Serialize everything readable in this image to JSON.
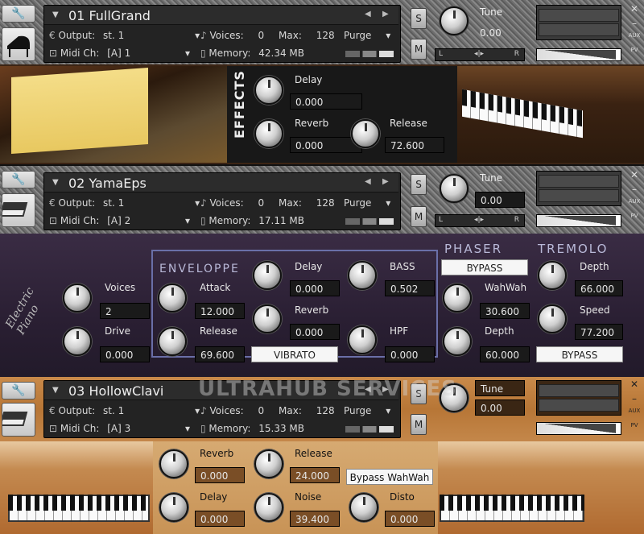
{
  "instruments": [
    {
      "name": "01 FullGrand",
      "output_label": "Output:",
      "output": "st. 1",
      "voices_label": "Voices:",
      "voices": "0",
      "max_label": "Max:",
      "max": "128",
      "purge": "Purge",
      "midi_label": "Midi Ch:",
      "midi": "[A]  1",
      "memory_label": "Memory:",
      "memory": "42.34 MB",
      "tune_label": "Tune",
      "tune": "0.00",
      "s": "S",
      "m": "M",
      "l": "L",
      "r": "R",
      "aux": "AUX",
      "pv": "PV"
    },
    {
      "name": "02 YamaEps",
      "output_label": "Output:",
      "output": "st. 1",
      "voices_label": "Voices:",
      "voices": "0",
      "max_label": "Max:",
      "max": "128",
      "purge": "Purge",
      "midi_label": "Midi Ch:",
      "midi": "[A]  2",
      "memory_label": "Memory:",
      "memory": "17.11 MB",
      "tune_label": "Tune",
      "tune": "0.00",
      "s": "S",
      "m": "M",
      "l": "L",
      "r": "R",
      "aux": "AUX",
      "pv": "PV"
    },
    {
      "name": "03 HollowClavi",
      "output_label": "Output:",
      "output": "st. 1",
      "voices_label": "Voices:",
      "voices": "0",
      "max_label": "Max:",
      "max": "128",
      "purge": "Purge",
      "midi_label": "Midi Ch:",
      "midi": "[A]  3",
      "memory_label": "Memory:",
      "memory": "15.33 MB",
      "tune_label": "Tune",
      "tune": "0.00",
      "s": "S",
      "m": "M",
      "l": "L",
      "r": "R",
      "aux": "AUX",
      "pv": "PV"
    }
  ],
  "effects1": {
    "title": "EFFECTS",
    "delay_label": "Delay",
    "delay": "0.000",
    "reverb_label": "Reverb",
    "reverb": "0.000",
    "release_label": "Release",
    "release": "72.600"
  },
  "effects2": {
    "enveloppe": "ENVELOPPE",
    "phaser": "PHASER",
    "tremolo": "TREMOLO",
    "voices_label": "Voices",
    "voices": "2",
    "drive_label": "Drive",
    "drive": "0.000",
    "attack_label": "Attack",
    "attack": "12.000",
    "release_label": "Release",
    "release": "69.600",
    "delay_label": "Delay",
    "delay": "0.000",
    "reverb_label": "Reverb",
    "reverb": "0.000",
    "vibrato": "VIBRATO",
    "bass_label": "BASS",
    "bass": "0.502",
    "hpf_label": "HPF",
    "hpf": "0.000",
    "phaser_bypass": "BYPASS",
    "wahwah_label": "WahWah",
    "wahwah": "30.600",
    "phaser_depth_label": "Depth",
    "phaser_depth": "60.000",
    "trem_depth_label": "Depth",
    "trem_depth": "66.000",
    "speed_label": "Speed",
    "speed": "77.200",
    "tremolo_bypass": "BYPASS"
  },
  "effects3": {
    "reverb_label": "Reverb",
    "reverb": "0.000",
    "release_label": "Release",
    "release": "24.000",
    "bypass_wahwah": "Bypass WahWah",
    "delay_label": "Delay",
    "delay": "0.000",
    "noise_label": "Noise",
    "noise": "39.400",
    "disto_label": "Disto",
    "disto": "0.000"
  },
  "watermark": "ULTRAHUB SERVICES",
  "icons": [
    "wrench-icon",
    "grand-piano-icon",
    "keyboard-icon",
    "close-icon",
    "minimize-icon"
  ]
}
